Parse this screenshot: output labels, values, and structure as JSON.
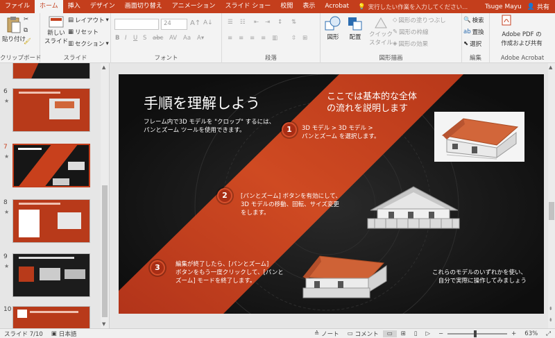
{
  "tabs": [
    "ファイル",
    "ホーム",
    "挿入",
    "デザイン",
    "画面切り替え",
    "アニメーション",
    "スライド ショー",
    "校閲",
    "表示",
    "Acrobat"
  ],
  "tell_me": "実行したい作業を入力してください...",
  "user": "Tsuge Mayu",
  "share_label": "共有",
  "clipboard": {
    "paste": "貼り付け",
    "label": "クリップボード"
  },
  "slides_grp": {
    "new": "新しい",
    "new2": "スライド",
    "layout": "レイアウト",
    "reset": "リセット",
    "section": "セクション",
    "label": "スライド"
  },
  "font": {
    "size": "24",
    "label": "フォント"
  },
  "paragraph": {
    "label": "段落"
  },
  "drawing": {
    "shape": "図形",
    "arrange": "配置",
    "quick1": "クイック",
    "quick2": "スタイル",
    "fill": "図形の塗りつぶし",
    "outline": "図形の枠線",
    "effect": "図形の効果",
    "label": "図形描画"
  },
  "editing": {
    "find": "検索",
    "replace": "置換",
    "select": "選択",
    "label": "編集"
  },
  "acrobat": {
    "line1": "Adobe PDF の",
    "line2": "作成および共有",
    "label": "Adobe Acrobat"
  },
  "thumbnails": [
    {
      "num": "6",
      "star": "★"
    },
    {
      "num": "7",
      "star": "★"
    },
    {
      "num": "8",
      "star": "★"
    },
    {
      "num": "9",
      "star": "★"
    },
    {
      "num": "10",
      "star": ""
    }
  ],
  "slide": {
    "title": "手順を理解しよう",
    "sub1": "フレーム内で3D モデルを \"クロップ\" するには、",
    "sub2": "パンとズーム ツールを使用できます。",
    "head1": "ここでは基本的な全体",
    "head2": "の流れを説明します",
    "step1_num": "1",
    "step1_a": "3D モデル > 3D モデル >",
    "step1_b": "パンとズーム を選択します。",
    "step2_num": "2",
    "step2_a": "[パンとズーム] ボタンを有効にして、",
    "step2_b": "3D モデルの移動、回転、サイズ変更",
    "step2_c": "をします。",
    "step3_num": "3",
    "step3_a": "編集が終了したら、[パンとズーム]",
    "step3_b": "ボタンをもう一度クリックして、[パンと",
    "step3_c": "ズーム] モードを終了します。",
    "end1": "これらのモデルのいずれかを使い、",
    "end2": "自分で実際に操作してみましょう"
  },
  "status": {
    "slide": "スライド 7/10",
    "lang": "日本語",
    "notes": "ノート",
    "comments": "コメント",
    "zoom": "63%"
  },
  "colors": {
    "accent": "#c43e1c",
    "slide_bg": "#161616",
    "band": "#c8401c"
  }
}
